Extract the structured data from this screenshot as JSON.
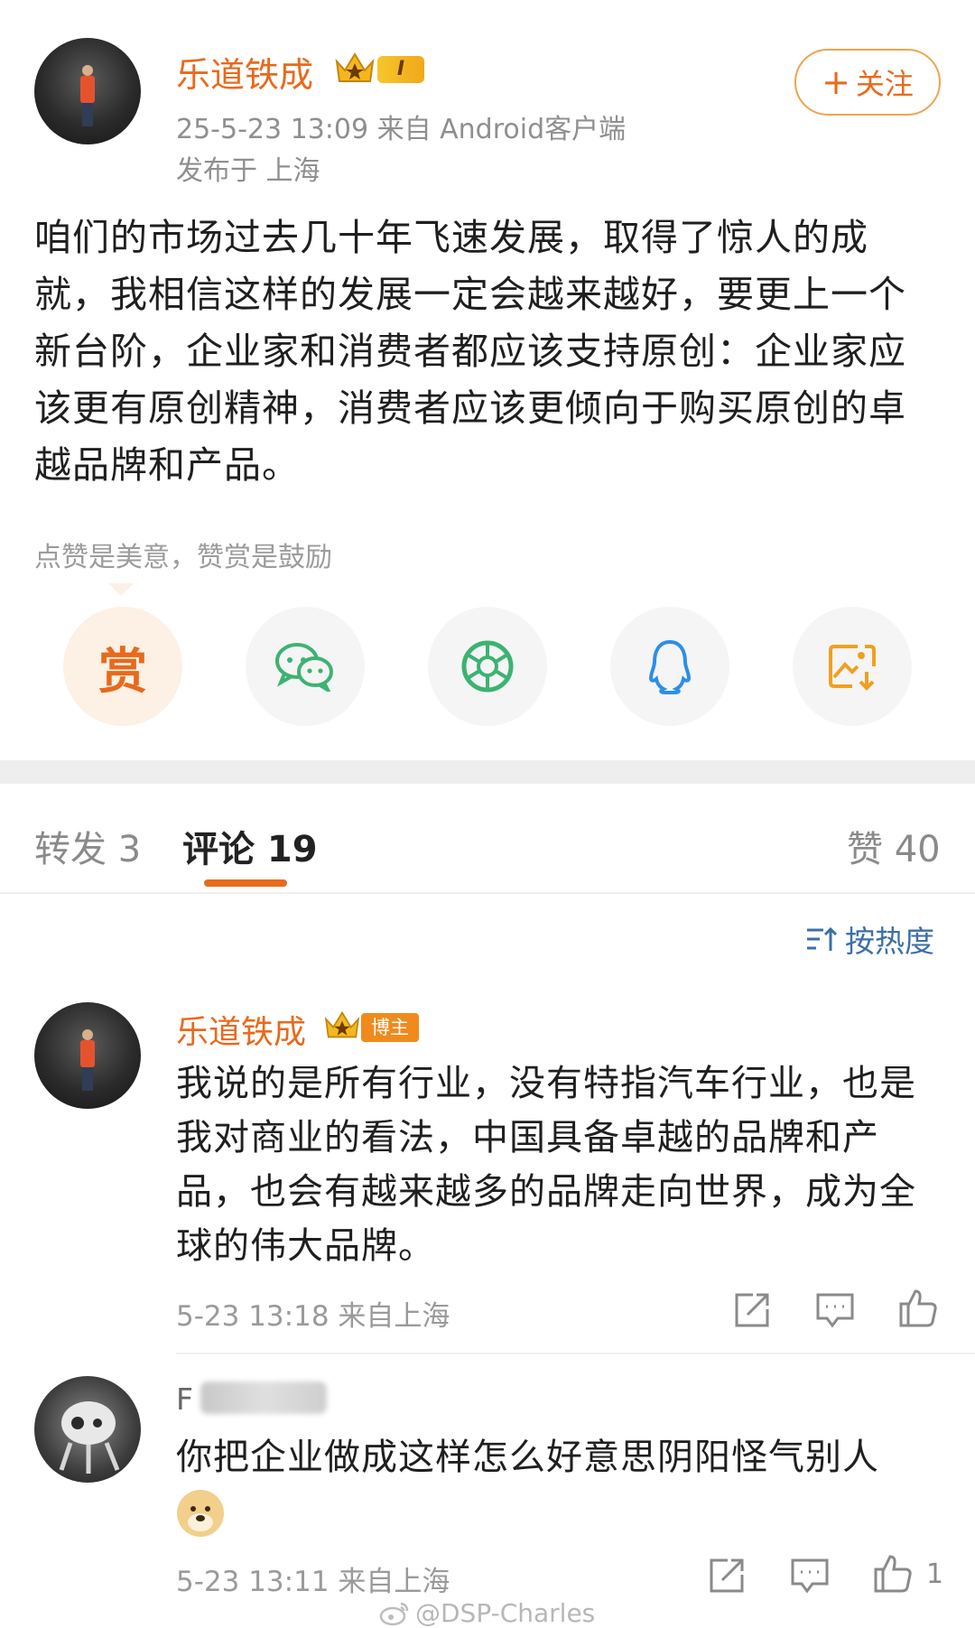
{
  "post": {
    "author": "乐道铁成",
    "level_badge": "I",
    "follow_label": "关注",
    "follow_plus": "+",
    "time_source": "25-5-23 13:09  来自 Android客户端",
    "location": "发布于 上海",
    "body": "咱们的市场过去几十年飞速发展，取得了惊人的成就，我相信这样的发展一定会越来越好，要更上一个新台阶，企业家和消费者都应该支持原创：企业家应该更有原创精神，消费者应该更倾向于购买原创的卓越品牌和产品。",
    "reward_hint": "点赞是美意，赞赏是鼓励"
  },
  "share": {
    "reward_char": "赏",
    "items": [
      "reward-icon",
      "wechat-icon",
      "moments-icon",
      "qq-icon",
      "save-image-icon"
    ]
  },
  "tabs": {
    "repost": "转发 3",
    "comments": "评论 19",
    "likes": "赞 40"
  },
  "sort_label": "按热度",
  "comments": [
    {
      "author": "乐道铁成",
      "badge": "博主",
      "text": "我说的是所有行业，没有特指汽车行业，也是我对商业的看法，中国具备卓越的品牌和产品，也会有越来越多的品牌走向世界，成为全球的伟大品牌。",
      "meta": "5-23 13:18  来自上海"
    },
    {
      "author_prefix": "F",
      "text": "你把企业做成这样怎么好意思阴阳怪气别人",
      "meta": "5-23 13:11  来自上海",
      "like_count": "1"
    }
  ],
  "watermark": "@DSP-Charles",
  "colors": {
    "accent_orange": "#e86a1c",
    "link_blue": "#3b6fa8",
    "wechat_green": "#3cb371",
    "qq_blue": "#2c8fe8",
    "save_orange": "#f0a020"
  }
}
